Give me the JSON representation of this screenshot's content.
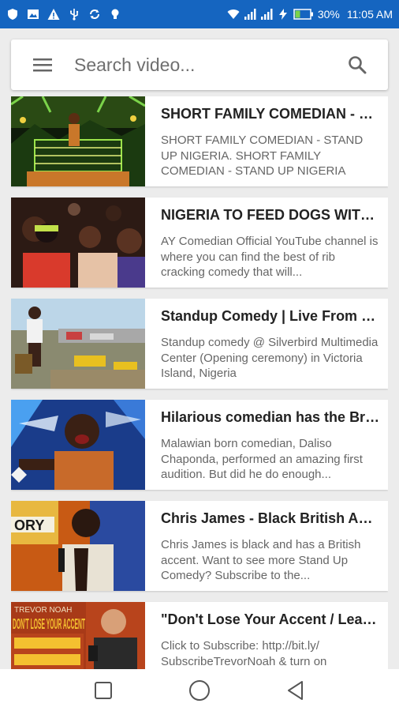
{
  "status_bar": {
    "battery": "30%",
    "time": "11:05 AM",
    "icons": [
      "shield-icon",
      "image-icon",
      "warning-icon",
      "usb-icon",
      "sync-icon",
      "bulb-icon",
      "wifi-icon",
      "signal-icon",
      "signal-icon",
      "charging-icon",
      "battery-icon"
    ]
  },
  "search": {
    "placeholder": "Search video...",
    "menu_icon": "hamburger-menu-icon",
    "search_icon": "search-icon"
  },
  "videos": [
    {
      "title": "SHORT FAMILY COMEDIAN - STAND UP NIGERIA",
      "description": "SHORT FAMILY COMEDIAN - STAND UP NIGERIA. SHORT FAMILY COMEDIAN - STAND UP NIGERIA"
    },
    {
      "title": "NIGERIA TO FEED DOGS WITH...",
      "description": "AY Comedian Official YouTube channel is where you can find the best of rib cracking comedy that will..."
    },
    {
      "title": "Standup Comedy | Live From Silverbird",
      "description": "Standup comedy @ Silverbird Multimedia Center (Opening ceremony) in Victoria Island, Nigeria"
    },
    {
      "title": "Hilarious comedian has the Britain's Got Talent",
      "description": "Malawian born comedian, Daliso Chaponda, performed an amazing first audition. But did he do enough..."
    },
    {
      "title": "Chris James - Black British Accent",
      "description": "Chris James is black and has a British accent. Want to see more Stand Up Comedy? Subscribe to the..."
    },
    {
      "title": "\"Don't Lose Your Accent / Learn...",
      "description": "Click to Subscribe: http://bit.ly/ SubscribeTrevorNoah & turn on notifications"
    }
  ],
  "thumbnail_texts": {
    "video_5": "ORY",
    "video_6_top": "TREVOR NOAH",
    "video_6_big": "DON'T LOSE YOUR ACCENT"
  },
  "nav": {
    "recent": "square-recent-apps-icon",
    "home": "circle-home-icon",
    "back": "triangle-back-icon"
  }
}
